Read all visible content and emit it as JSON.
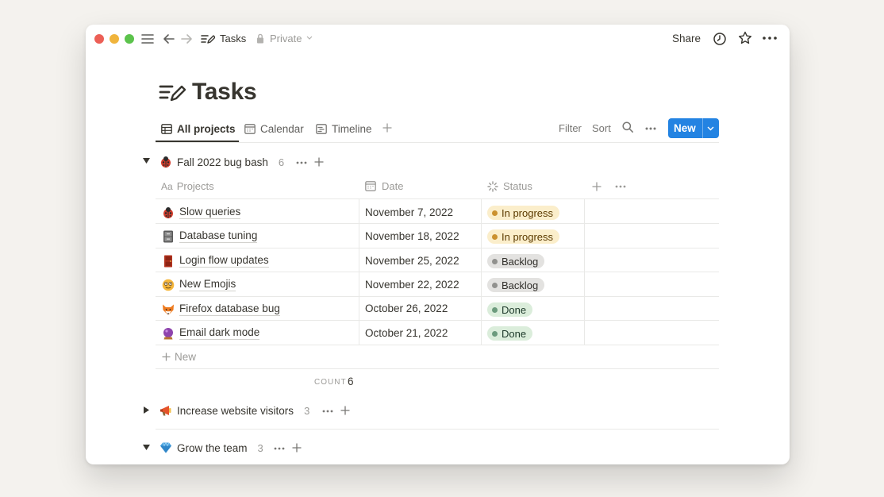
{
  "window": {
    "title": "Tasks",
    "privacy": "Private"
  },
  "topbar": {
    "share_label": "Share"
  },
  "page": {
    "title": "Tasks"
  },
  "tabs": [
    {
      "label": "All projects",
      "active": true
    },
    {
      "label": "Calendar",
      "active": false
    },
    {
      "label": "Timeline",
      "active": false
    }
  ],
  "toolbar": {
    "filter_label": "Filter",
    "sort_label": "Sort",
    "new_label": "New"
  },
  "columns": {
    "projects": "Projects",
    "date": "Date",
    "status": "Status",
    "aa": "Aa"
  },
  "groups": [
    {
      "title": "Fall 2022 bug bash",
      "count": "6",
      "expanded": true,
      "rows": [
        {
          "name": "Slow queries",
          "date": "November 7, 2022",
          "status": "In progress"
        },
        {
          "name": "Database tuning",
          "date": "November 18, 2022",
          "status": "In progress"
        },
        {
          "name": "Login flow updates",
          "date": "November 25, 2022",
          "status": "Backlog"
        },
        {
          "name": "New Emojis",
          "date": "November 22, 2022",
          "status": "Backlog"
        },
        {
          "name": "Firefox database bug",
          "date": "October 26, 2022",
          "status": "Done"
        },
        {
          "name": "Email dark mode",
          "date": "October 21, 2022",
          "status": "Done"
        }
      ],
      "new_row_label": "New",
      "count_label": "COUNT",
      "count_value": "6"
    },
    {
      "title": "Increase website visitors",
      "count": "3",
      "expanded": false
    },
    {
      "title": "Grow the team",
      "count": "3",
      "expanded": true
    }
  ],
  "colors": {
    "accent": "#2383e2",
    "in_progress_bg": "#fbeecb",
    "in_progress_dot": "#cb912f",
    "backlog_bg": "#e3e2e0",
    "backlog_dot": "#91918e",
    "done_bg": "#dbeddb",
    "done_dot": "#6c9b7d"
  }
}
